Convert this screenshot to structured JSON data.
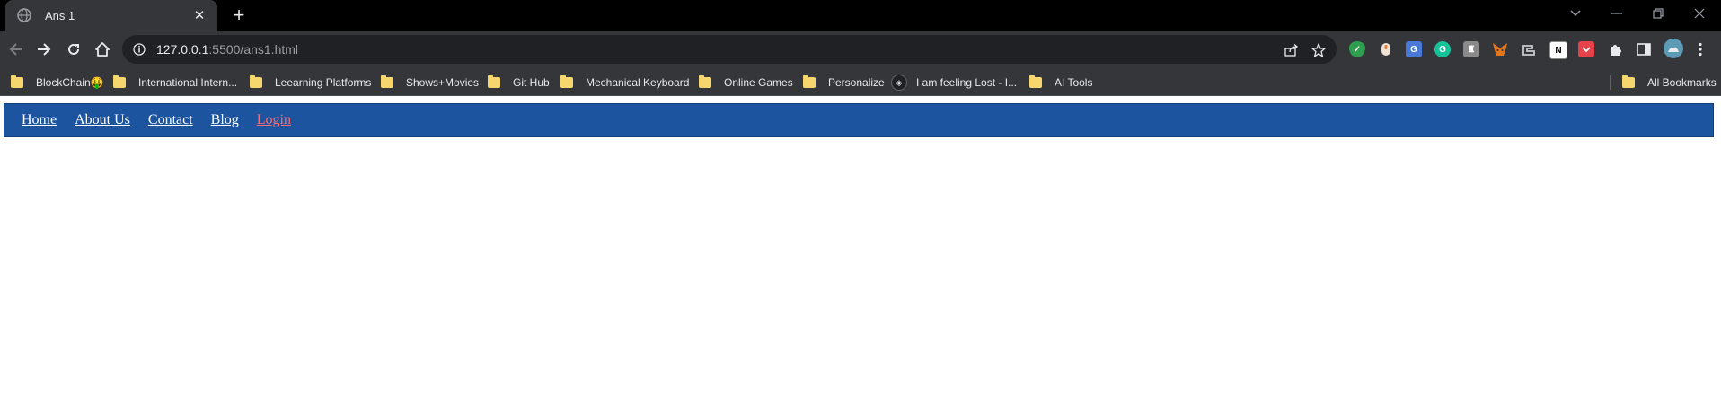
{
  "browser": {
    "tab": {
      "title": "Ans 1",
      "favicon": "globe-icon"
    },
    "new_tab_icon": "plus-icon",
    "url": {
      "host": "127.0.0.1",
      "path": ":5500/ans1.html"
    },
    "window_controls": [
      "tab-search-icon",
      "minimize-icon",
      "restore-icon",
      "close-icon"
    ]
  },
  "bookmarks": {
    "items": [
      {
        "label": "BlockChain🤑",
        "icon": "folder-icon"
      },
      {
        "label": "International Intern...",
        "icon": "folder-icon"
      },
      {
        "label": "Leearning Platforms",
        "icon": "folder-icon"
      },
      {
        "label": "Shows+Movies",
        "icon": "folder-icon"
      },
      {
        "label": "Git Hub",
        "icon": "folder-icon"
      },
      {
        "label": "Mechanical Keyboard",
        "icon": "folder-icon"
      },
      {
        "label": "Online Games",
        "icon": "folder-icon"
      },
      {
        "label": "Personalize",
        "icon": "folder-icon"
      },
      {
        "label": "I am feeling Lost - I...",
        "icon": "site-icon"
      },
      {
        "label": "AI Tools",
        "icon": "folder-icon"
      }
    ],
    "all_bookmarks": "All Bookmarks"
  },
  "page": {
    "nav": {
      "items": [
        {
          "label": "Home"
        },
        {
          "label": "About Us"
        },
        {
          "label": "Contact"
        },
        {
          "label": "Blog"
        },
        {
          "label": "Login"
        }
      ]
    }
  },
  "colors": {
    "navbar_bg": "#1c54a0",
    "nav_link": "#ffffff",
    "login_link": "#ff6b6b",
    "chrome_dark": "#35363a"
  }
}
